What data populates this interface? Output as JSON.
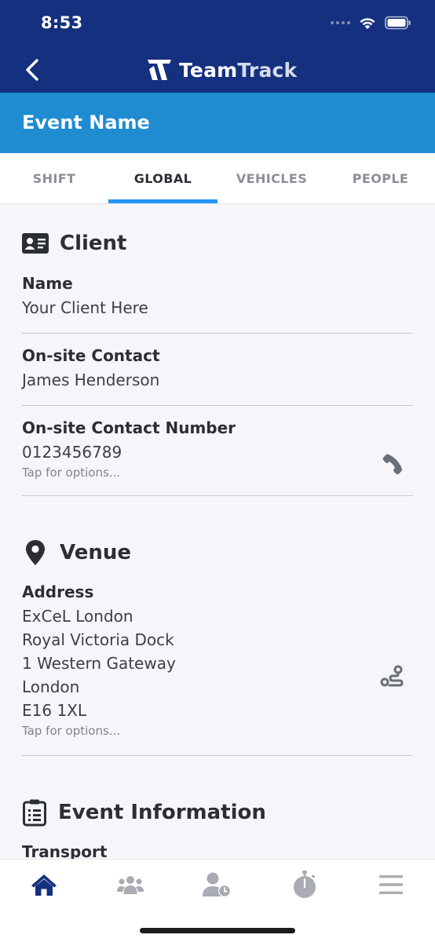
{
  "status_bar": {
    "time": "8:53"
  },
  "nav": {
    "brand_bold": "Team",
    "brand_light": "Track"
  },
  "event": {
    "title": "Event Name"
  },
  "tabs": [
    {
      "label": "SHIFT"
    },
    {
      "label": "GLOBAL",
      "active": true
    },
    {
      "label": "VEHICLES"
    },
    {
      "label": "PEOPLE"
    }
  ],
  "client": {
    "title": "Client",
    "name_label": "Name",
    "name_value": "Your Client Here",
    "contact_label": "On-site Contact",
    "contact_value": "James Henderson",
    "number_label": "On-site Contact Number",
    "number_value": "0123456789",
    "number_hint": "Tap for options..."
  },
  "venue": {
    "title": "Venue",
    "address_label": "Address",
    "address_lines": [
      "ExCeL London",
      "Royal Victoria Dock",
      "1 Western Gateway",
      "London",
      "E16 1XL"
    ],
    "address_hint": "Tap for options..."
  },
  "event_info": {
    "title": "Event Information",
    "transport_label": "Transport"
  },
  "bottom_nav": [
    {
      "icon": "home-icon",
      "active": true
    },
    {
      "icon": "people-icon"
    },
    {
      "icon": "person-clock-icon"
    },
    {
      "icon": "stopwatch-icon"
    },
    {
      "icon": "menu-icon"
    }
  ],
  "colors": {
    "nav_background": "#14307f",
    "event_header": "#1f8bd1",
    "tab_underline": "#2196f3",
    "active_nav_icon": "#14307f",
    "inactive_nav_icon": "#a9acb2"
  }
}
